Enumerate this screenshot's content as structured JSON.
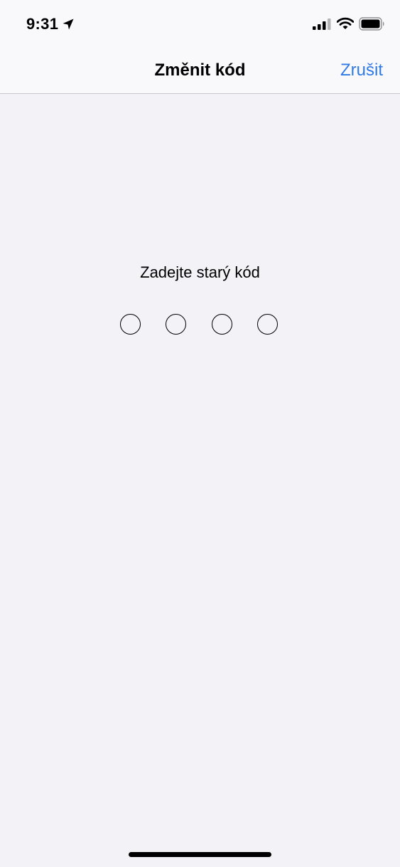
{
  "status_bar": {
    "time": "9:31",
    "icons": [
      "location-arrow-icon",
      "cellular-signal-icon",
      "wifi-icon",
      "battery-icon"
    ]
  },
  "nav": {
    "title": "Změnit kód",
    "cancel_label": "Zrušit"
  },
  "passcode": {
    "prompt": "Zadejte starý kód",
    "digits_total": 4,
    "digits_entered": 0
  },
  "colors": {
    "accent": "#2f7ae5",
    "background": "#f2f2f7",
    "nav_background": "#f9f9fb"
  }
}
